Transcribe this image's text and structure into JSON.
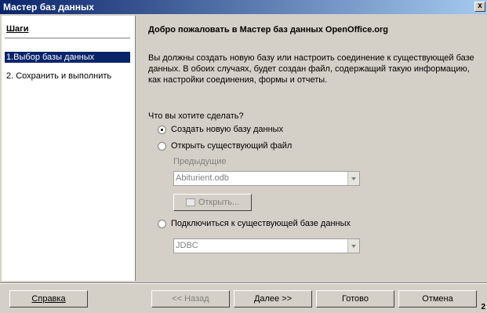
{
  "window": {
    "title": "Мастер баз данных",
    "close_label": "x"
  },
  "steps": {
    "title": "Шаги",
    "items": [
      {
        "label": "1.Выбор базы данных",
        "active": true
      },
      {
        "label": "2. Сохранить и выполнить",
        "active": false
      }
    ]
  },
  "content": {
    "heading": "Добро пожаловать в Мастер баз данных OpenOffice.org",
    "description": "Вы должны создать новую базу или настроить соединение к существующей базе данных. В обоих случаях, будет создан файл, содержащий такую информацию, как настройки соединения, формы и отчеты.",
    "question": "Что вы хотите сделать?",
    "options": [
      {
        "label": "Создать новую базу данных",
        "checked": true
      },
      {
        "label": "Открыть существующий файл",
        "checked": false
      },
      {
        "label": "Подключиться к существующей базе данных",
        "checked": false
      }
    ],
    "recent_label": "Предыдущие",
    "recent_value": "Abiturient.odb",
    "open_button": "Открыть...",
    "connection_value": "JDBC"
  },
  "buttons": {
    "help": "Справка",
    "back": "<< Назад",
    "next": "Далее >>",
    "finish": "Готово",
    "cancel": "Отмена"
  },
  "corner_mark": "2"
}
